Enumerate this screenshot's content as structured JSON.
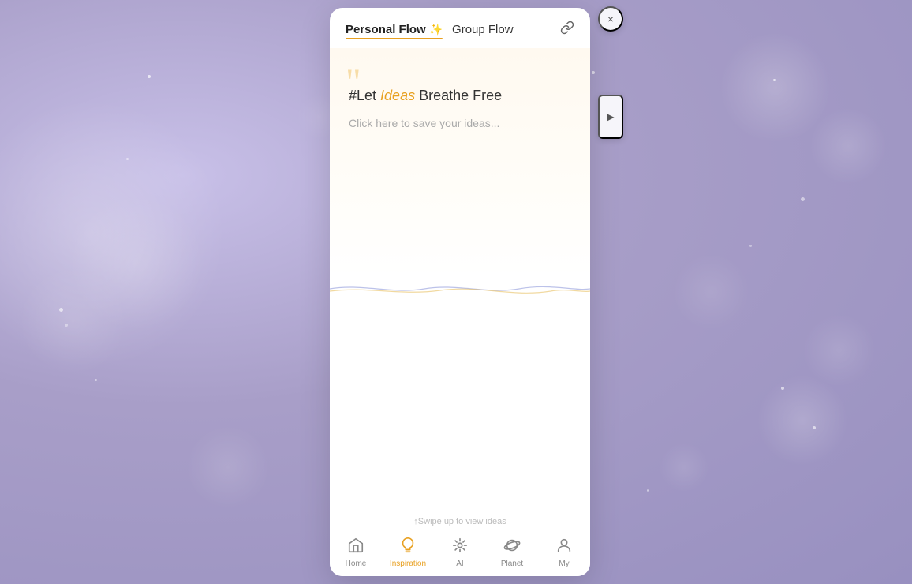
{
  "background": {
    "color": "#b0a8cc"
  },
  "modal": {
    "tabs": [
      {
        "id": "personal",
        "label": "Personal Flow",
        "icon": "✨",
        "active": true
      },
      {
        "id": "group",
        "label": "Group Flow",
        "active": false
      }
    ],
    "link_icon": "🔗",
    "headline": {
      "prefix": "#Let ",
      "highlight": "Ideas",
      "suffix": " Breathe Free"
    },
    "subtext": "Click here to save your ideas...",
    "swipe_hint": "↑Swipe up to view ideas",
    "close_label": "×",
    "arrow_label": "▶"
  },
  "nav": {
    "items": [
      {
        "id": "home",
        "label": "Home",
        "icon": "home",
        "active": false
      },
      {
        "id": "inspiration",
        "label": "Inspiration",
        "icon": "bulb",
        "active": true
      },
      {
        "id": "ai",
        "label": "AI",
        "icon": "ai",
        "active": false
      },
      {
        "id": "planet",
        "label": "Planet",
        "icon": "planet",
        "active": false
      },
      {
        "id": "my",
        "label": "My",
        "icon": "person",
        "active": false
      }
    ]
  }
}
